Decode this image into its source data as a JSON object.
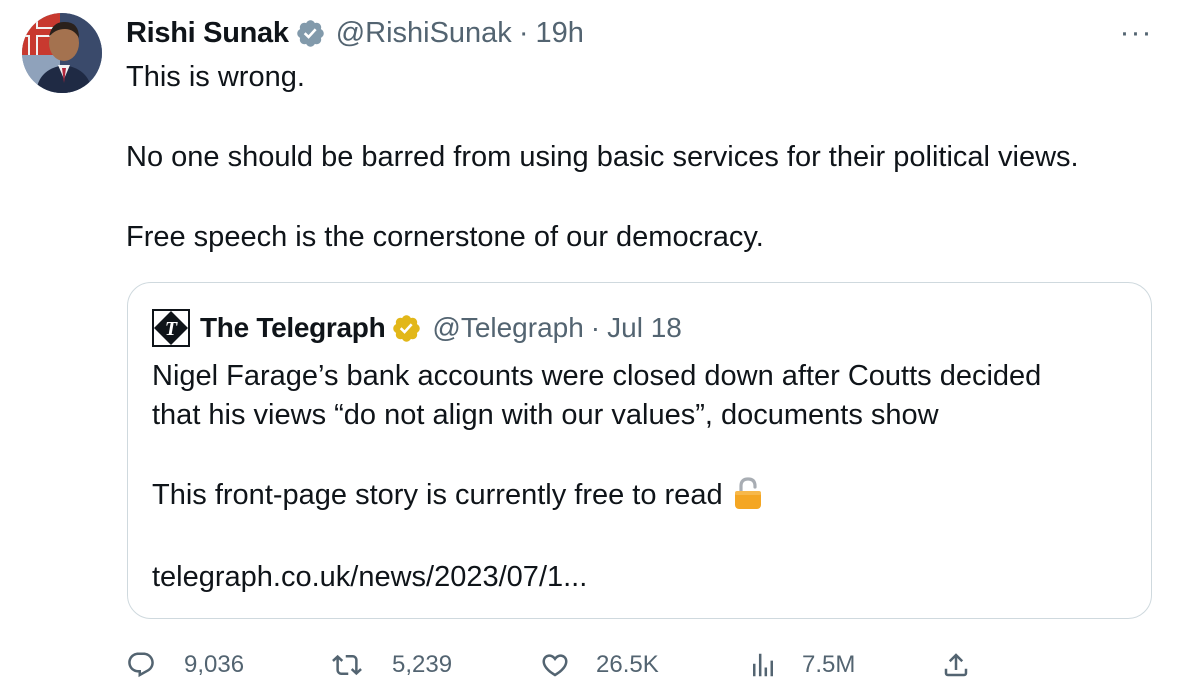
{
  "author": {
    "name": "Rishi Sunak",
    "handle": "@RishiSunak",
    "separator": "·",
    "time": "19h"
  },
  "tweet": {
    "lines": [
      "This is wrong.",
      "No one should be barred from using basic services for their political views.",
      "Free speech is the cornerstone of our democracy."
    ]
  },
  "more_label": "···",
  "quote": {
    "name": "The Telegraph",
    "handle": "@Telegraph",
    "separator": "·",
    "time": "Jul 18",
    "lines": [
      "Nigel Farage’s bank accounts were closed down after Coutts decided",
      "that his views “do not align with our values”, documents show",
      "This front-page story is currently free to read",
      "telegraph.co.uk/news/2023/07/1..."
    ]
  },
  "actions": {
    "replies": "9,036",
    "retweets": "5,239",
    "likes": "26.5K",
    "views": "7.5M"
  },
  "icons": {
    "verified_blue": "verified-badge-icon",
    "verified_gold": "verified-gold-badge-icon",
    "reply": "reply-icon",
    "retweet": "retweet-icon",
    "like": "heart-icon",
    "views": "views-chart-icon",
    "share": "share-icon",
    "lock": "open-lock-icon"
  },
  "colors": {
    "text": "#0f1419",
    "secondary": "#536471",
    "border": "#cfd9de",
    "verified_blue": "#829aab",
    "verified_gold": "#e2b719",
    "lock": "#f4a623"
  }
}
